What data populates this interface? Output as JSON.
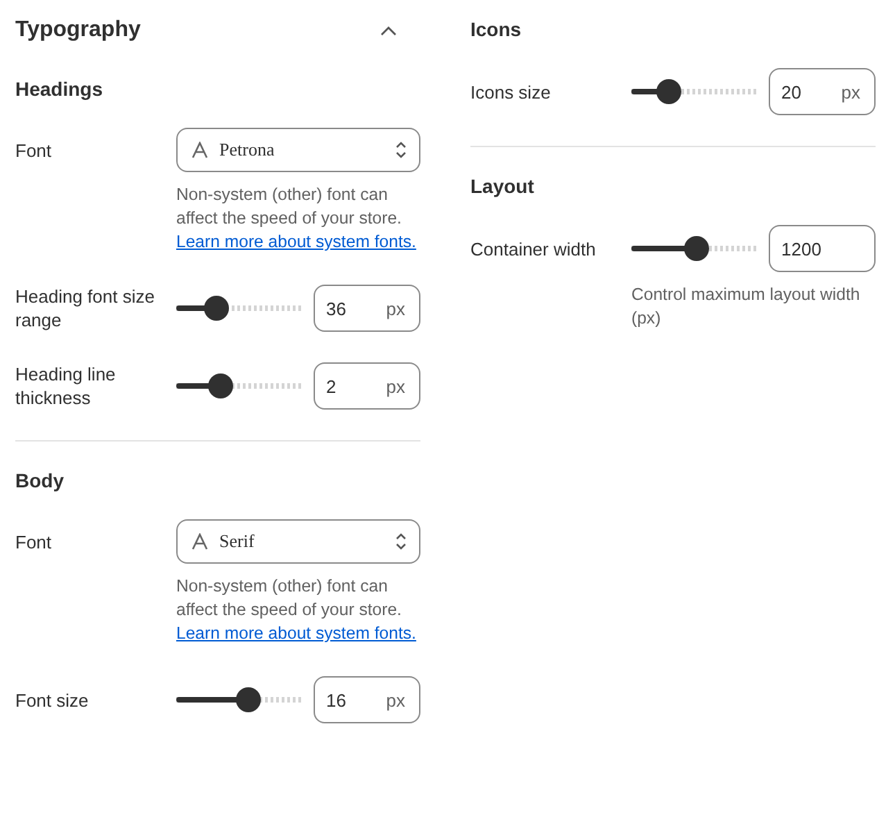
{
  "typography": {
    "title": "Typography",
    "expanded": true,
    "sections": [
      {
        "title": "Headings",
        "rows": [
          {
            "kind": "font",
            "label": "Font",
            "value": "Petrona",
            "help": "Non-system (other) font can affect the speed of your store.",
            "link": "Learn more about system fonts."
          },
          {
            "kind": "range",
            "label": "Heading font size range",
            "level": 0.32,
            "value": "36",
            "unit": "px"
          },
          {
            "kind": "range",
            "label": "Heading line thickness",
            "level": 0.36,
            "value": "2",
            "unit": "px"
          }
        ]
      },
      {
        "title": "Body",
        "rows": [
          {
            "kind": "font",
            "label": "Font",
            "value": "Serif",
            "help": "Non-system (other) font can affect the speed of your store.",
            "link": "Learn more about system fonts."
          },
          {
            "kind": "range",
            "label": "Font size",
            "level": 0.58,
            "value": "16",
            "unit": "px"
          }
        ]
      }
    ]
  },
  "right": {
    "sections": [
      {
        "title": "Icons",
        "rows": [
          {
            "kind": "range",
            "label": "Icons size",
            "level": 0.3,
            "value": "20",
            "unit": "px"
          }
        ]
      },
      {
        "title": "Layout",
        "rows": [
          {
            "kind": "range",
            "label": "Container width",
            "level": 0.52,
            "value": "1200",
            "hint": "Control maximum layout width (px)"
          }
        ]
      }
    ]
  }
}
